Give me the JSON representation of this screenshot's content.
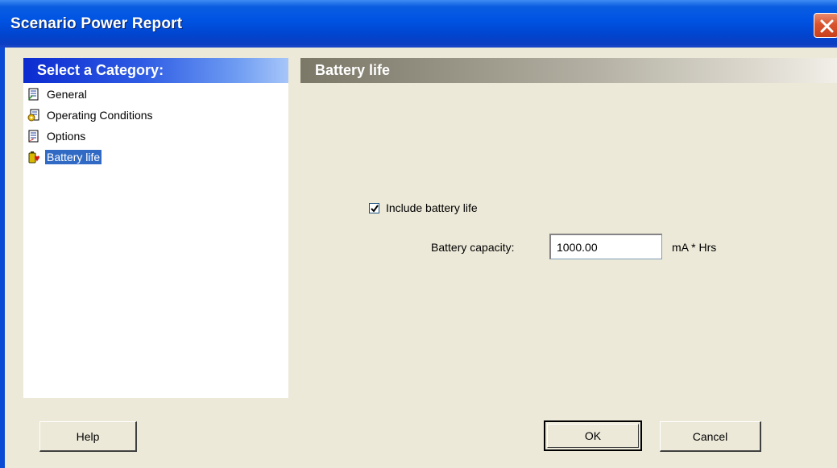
{
  "window": {
    "title": "Scenario Power Report",
    "close_icon": "close-icon"
  },
  "category_panel": {
    "header": "Select a Category:",
    "items": [
      {
        "label": "General",
        "icon": "document-icon",
        "selected": false
      },
      {
        "label": "Operating Conditions",
        "icon": "settings-document-icon",
        "selected": false
      },
      {
        "label": "Options",
        "icon": "options-document-icon",
        "selected": false
      },
      {
        "label": "Battery life",
        "icon": "battery-icon",
        "selected": true
      }
    ]
  },
  "section": {
    "header": "Battery life",
    "include_checkbox": {
      "label": "Include battery life",
      "checked": true
    },
    "capacity": {
      "label": "Battery capacity:",
      "value": "1000.00",
      "unit": "mA * Hrs"
    }
  },
  "buttons": {
    "help": "Help",
    "ok": "OK",
    "cancel": "Cancel"
  },
  "colors": {
    "titlebar": "#0054e3",
    "selection": "#316ac5",
    "dialog_bg": "#ece9d8"
  }
}
